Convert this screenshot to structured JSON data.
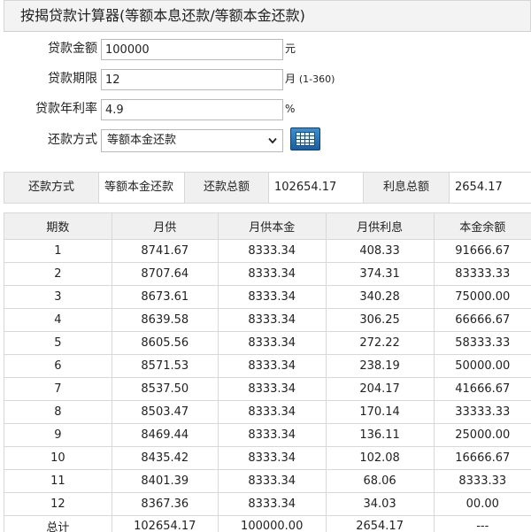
{
  "title": "按揭贷款计算器(等额本息还款/等额本金还款)",
  "form": {
    "amount": {
      "label": "贷款金额",
      "value": "100000",
      "unit": "元"
    },
    "term": {
      "label": "贷款期限",
      "value": "12",
      "unit": "月",
      "hint": "(1-360)"
    },
    "rate": {
      "label": "贷款年利率",
      "value": "4.9",
      "unit": "%"
    },
    "method": {
      "label": "还款方式",
      "selected": "等额本金还款"
    },
    "calculator_icon": "calculator-icon"
  },
  "summary": {
    "method_label": "还款方式",
    "method_value": "等额本金还款",
    "total_label": "还款总额",
    "total_value": "102654.17",
    "interest_label": "利息总额",
    "interest_value": "2654.17"
  },
  "table": {
    "headers": [
      "期数",
      "月供",
      "月供本金",
      "月供利息",
      "本金余额"
    ],
    "rows": [
      [
        "1",
        "8741.67",
        "8333.34",
        "408.33",
        "91666.67"
      ],
      [
        "2",
        "8707.64",
        "8333.34",
        "374.31",
        "83333.33"
      ],
      [
        "3",
        "8673.61",
        "8333.34",
        "340.28",
        "75000.00"
      ],
      [
        "4",
        "8639.58",
        "8333.34",
        "306.25",
        "66666.67"
      ],
      [
        "5",
        "8605.56",
        "8333.34",
        "272.22",
        "58333.33"
      ],
      [
        "6",
        "8571.53",
        "8333.34",
        "238.19",
        "50000.00"
      ],
      [
        "7",
        "8537.50",
        "8333.34",
        "204.17",
        "41666.67"
      ],
      [
        "8",
        "8503.47",
        "8333.34",
        "170.14",
        "33333.33"
      ],
      [
        "9",
        "8469.44",
        "8333.34",
        "136.11",
        "25000.00"
      ],
      [
        "10",
        "8435.42",
        "8333.34",
        "102.08",
        "16666.67"
      ],
      [
        "11",
        "8401.39",
        "8333.34",
        "68.06",
        "8333.33"
      ],
      [
        "12",
        "8367.36",
        "8333.34",
        "34.03",
        "00.00"
      ]
    ],
    "total": [
      "总计",
      "102654.17",
      "100000.00",
      "2654.17",
      "---"
    ]
  }
}
